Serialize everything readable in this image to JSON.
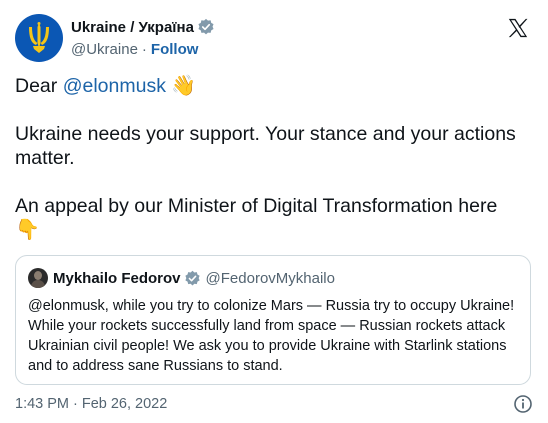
{
  "author": {
    "display_name": "Ukraine / Україна",
    "handle": "@Ukraine",
    "separator": "·",
    "follow_label": "Follow",
    "avatar_color": "#0b57b4",
    "avatar_icon": "trident-coat-of-arms",
    "verified_icon": "verified-badge-icon"
  },
  "tweet": {
    "greeting": "Dear ",
    "mention": "@elonmusk",
    "wave_emoji": "👋",
    "line2": "Ukraine needs your support. Your stance and your actions matter.",
    "line3": "An appeal by our Minister of Digital Transformation here",
    "point_emoji": "👇",
    "mention_color": "#1d64a8"
  },
  "quote": {
    "display_name": "Mykhailo Fedorov",
    "handle": "@FedorovMykhailo",
    "text": "@elonmusk, while you try to colonize Mars — Russia try to occupy Ukraine! While your rockets successfully land from space — Russian rockets attack Ukrainian civil people! We ask you to provide Ukraine with Starlink stations and to address sane Russians to stand."
  },
  "footer": {
    "time": "1:43 PM",
    "separator": "·",
    "date": "Feb 26, 2022",
    "info_icon": "info-icon"
  },
  "brand": {
    "logo_icon": "x-logo-icon"
  }
}
